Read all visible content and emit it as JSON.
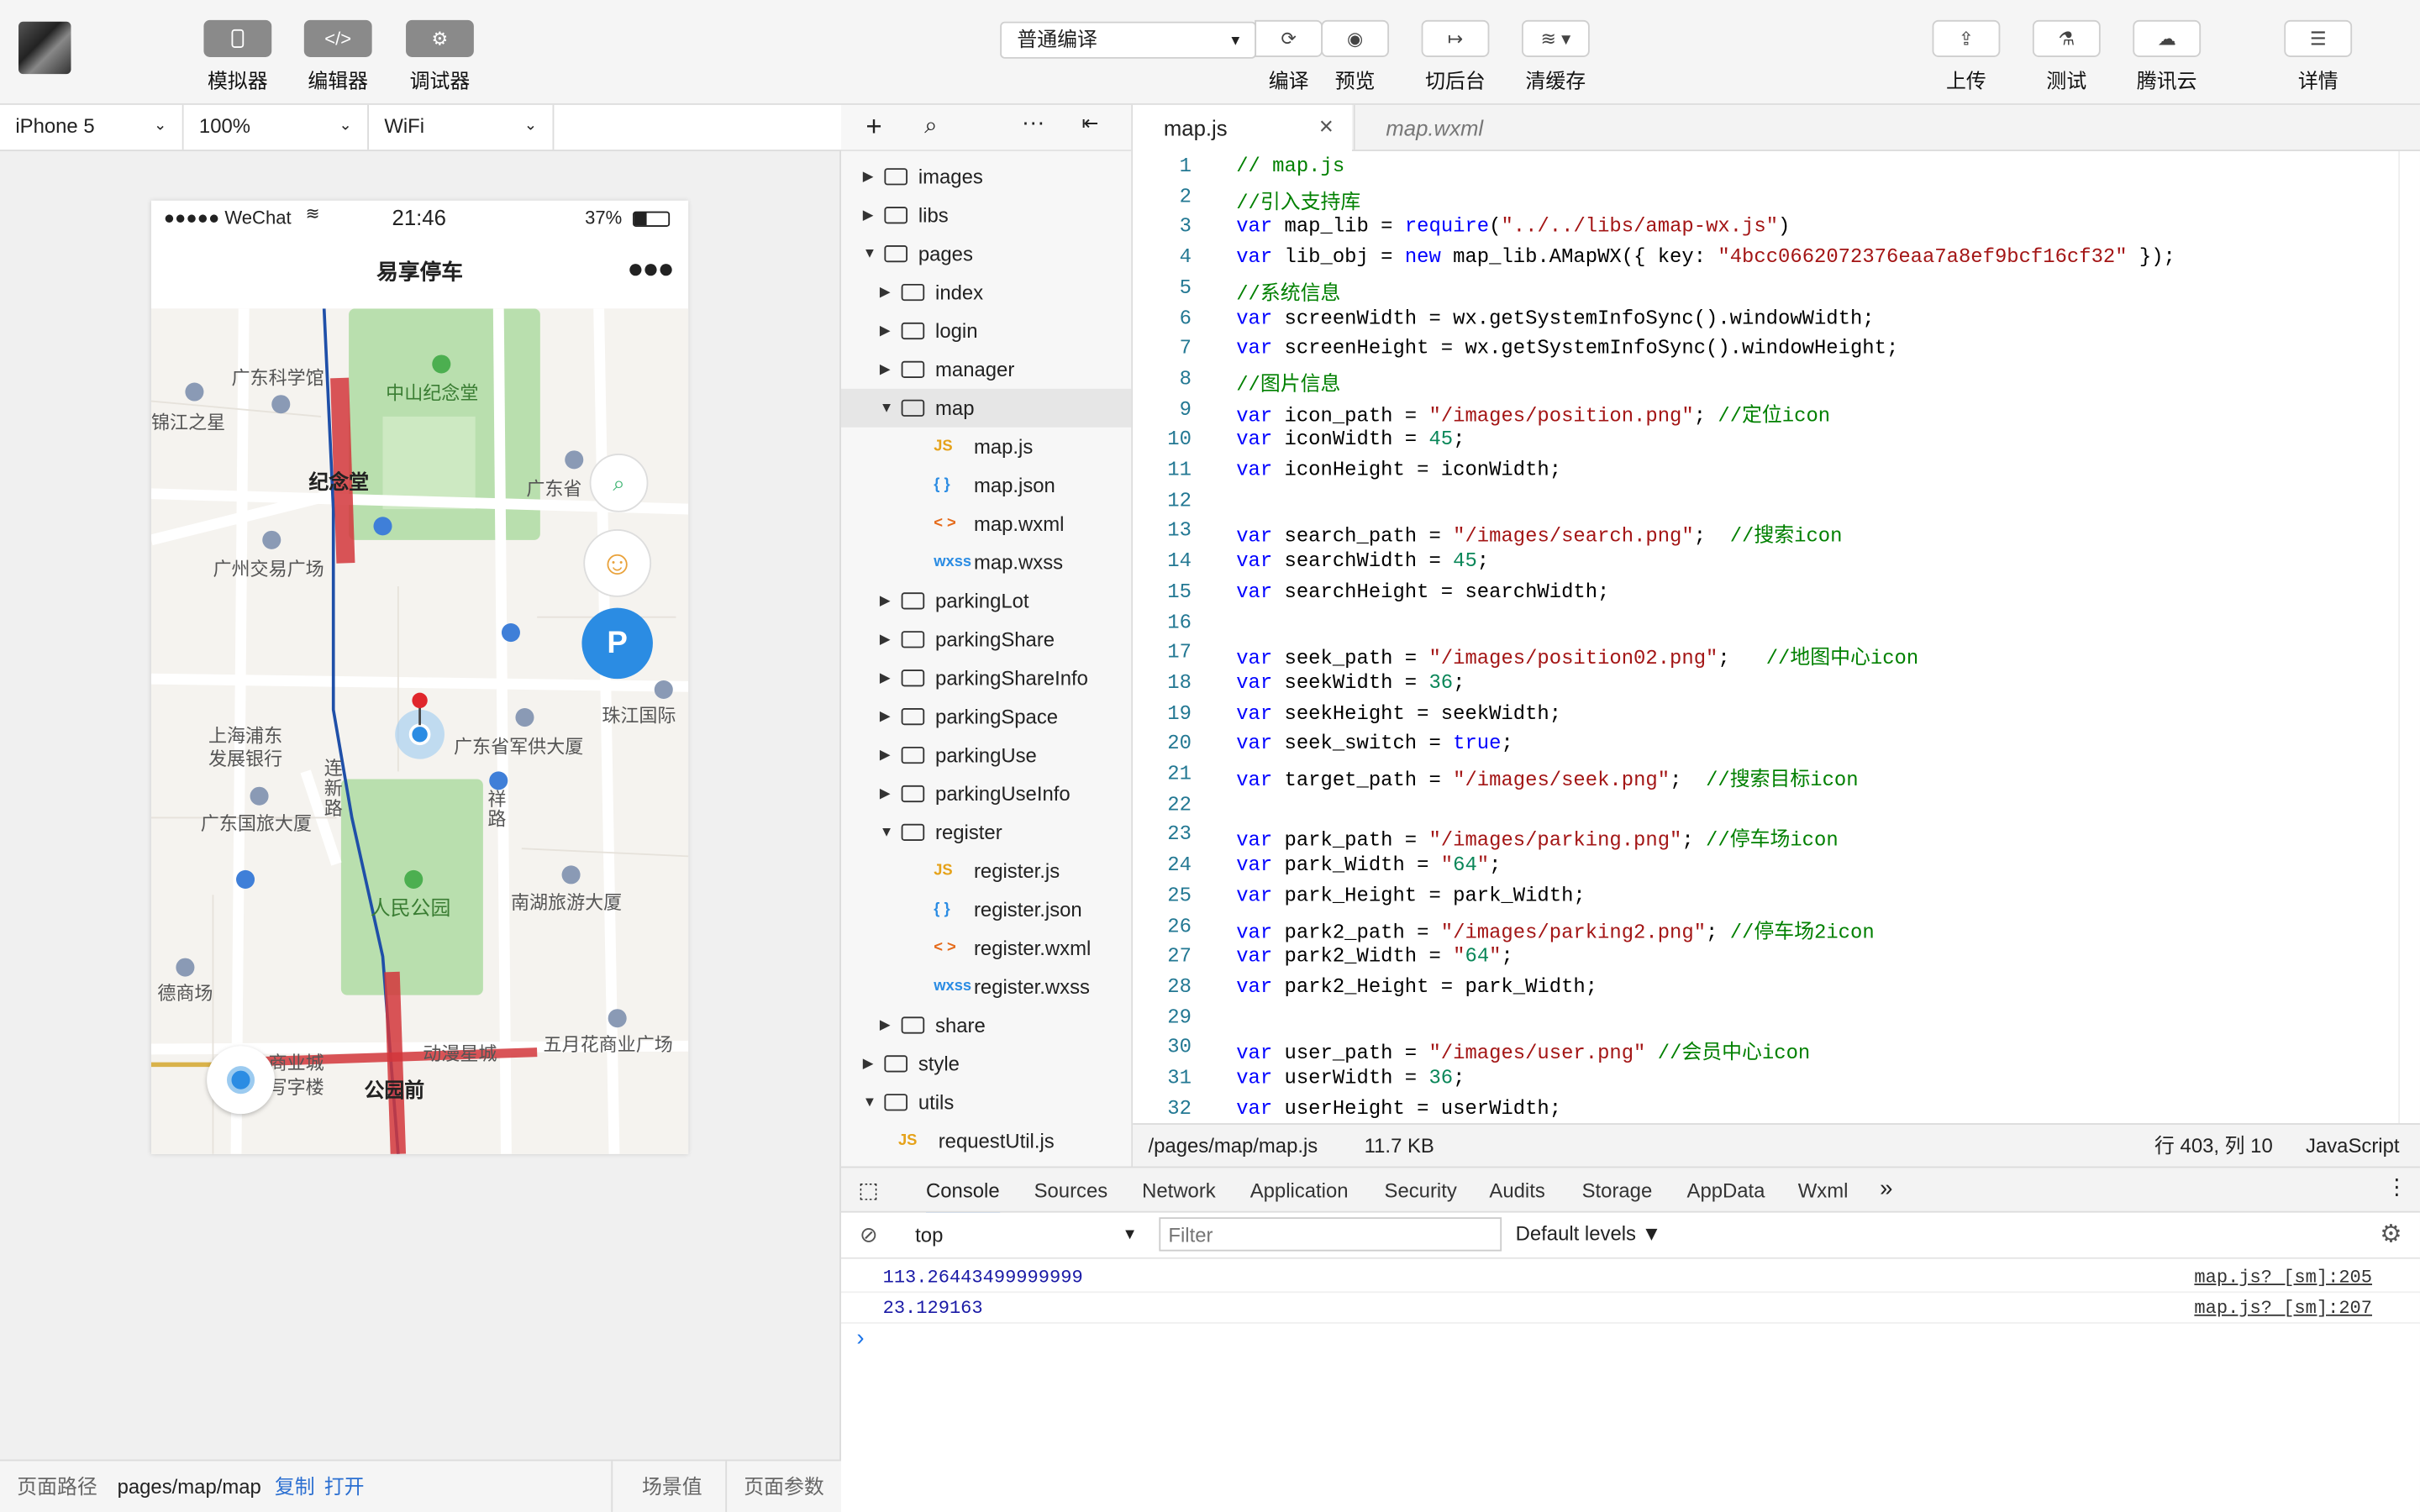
{
  "toolbar": {
    "simulator": "模拟器",
    "editor": "编辑器",
    "debugger": "调试器",
    "compile_mode": "普通编译",
    "compile": "编译",
    "preview": "预览",
    "background": "切后台",
    "clear_cache": "清缓存",
    "upload": "上传",
    "test": "测试",
    "tencent_cloud": "腾讯云",
    "details": "详情"
  },
  "device_bar": {
    "device": "iPhone 5",
    "zoom": "100%",
    "network": "WiFi"
  },
  "phone": {
    "signal": "●●●●● WeChat",
    "time": "21:46",
    "battery": "37%",
    "title": "易享停车",
    "more": "●●●"
  },
  "map": {
    "labels": [
      "广东科学馆",
      "锦江之星",
      "中山纪念堂",
      "纪念堂",
      "广东省",
      "广州交易广场",
      "珠江国际",
      "上海浦东",
      "发展银行",
      "广东省军供大厦",
      "连新路",
      "祥路",
      "广东国旅大厦",
      "人民公园",
      "南湖旅游大厦",
      "德商场",
      "五月花商业广场",
      "动漫星城",
      "商业城",
      "写字楼",
      "公园前"
    ]
  },
  "path_bar": {
    "label": "页面路径",
    "path": "pages/map/map",
    "copy": "复制",
    "open": "打开",
    "scene": "场景值",
    "params": "页面参数"
  },
  "tree": {
    "rows": [
      {
        "name": "images",
        "type": "folder",
        "depth": 0,
        "open": false
      },
      {
        "name": "libs",
        "type": "folder",
        "depth": 0,
        "open": false
      },
      {
        "name": "pages",
        "type": "folder",
        "depth": 0,
        "open": true
      },
      {
        "name": "index",
        "type": "folder",
        "depth": 1,
        "open": false
      },
      {
        "name": "login",
        "type": "folder",
        "depth": 1,
        "open": false
      },
      {
        "name": "manager",
        "type": "folder",
        "depth": 1,
        "open": false
      },
      {
        "name": "map",
        "type": "folder",
        "depth": 1,
        "open": true,
        "selected": true
      },
      {
        "name": "map.js",
        "type": "js",
        "depth": 2
      },
      {
        "name": "map.json",
        "type": "json",
        "depth": 2
      },
      {
        "name": "map.wxml",
        "type": "wxml",
        "depth": 2
      },
      {
        "name": "map.wxss",
        "type": "wxss",
        "depth": 2
      },
      {
        "name": "parkingLot",
        "type": "folder",
        "depth": 1,
        "open": false
      },
      {
        "name": "parkingShare",
        "type": "folder",
        "depth": 1,
        "open": false
      },
      {
        "name": "parkingShareInfo",
        "type": "folder",
        "depth": 1,
        "open": false
      },
      {
        "name": "parkingSpace",
        "type": "folder",
        "depth": 1,
        "open": false
      },
      {
        "name": "parkingUse",
        "type": "folder",
        "depth": 1,
        "open": false
      },
      {
        "name": "parkingUseInfo",
        "type": "folder",
        "depth": 1,
        "open": false
      },
      {
        "name": "register",
        "type": "folder",
        "depth": 1,
        "open": true
      },
      {
        "name": "register.js",
        "type": "js",
        "depth": 2
      },
      {
        "name": "register.json",
        "type": "json",
        "depth": 2
      },
      {
        "name": "register.wxml",
        "type": "wxml",
        "depth": 2
      },
      {
        "name": "register.wxss",
        "type": "wxss",
        "depth": 2
      },
      {
        "name": "share",
        "type": "folder",
        "depth": 1,
        "open": false
      },
      {
        "name": "style",
        "type": "folder",
        "depth": 0,
        "open": false
      },
      {
        "name": "utils",
        "type": "folder",
        "depth": 0,
        "open": true
      },
      {
        "name": "requestUtil.js",
        "type": "js",
        "depth": 1
      }
    ]
  },
  "editor": {
    "tabs": [
      "map.js",
      "map.wxml"
    ],
    "lines": [
      "// map.js",
      "//引入支持库",
      "var map_lib = require(\"../../libs/amap-wx.js\")",
      "var lib_obj = new map_lib.AMapWX({ key: \"4bcc0662072376eaa7a8ef9bcf16cf32\" });",
      "//系统信息",
      "var screenWidth = wx.getSystemInfoSync().windowWidth;",
      "var screenHeight = wx.getSystemInfoSync().windowHeight;",
      "//图片信息",
      "var icon_path = \"/images/position.png\"; //定位icon",
      "var iconWidth = 45;",
      "var iconHeight = iconWidth;",
      "",
      "var search_path = \"/images/search.png\";  //搜索icon",
      "var searchWidth = 45;",
      "var searchHeight = searchWidth;",
      "",
      "var seek_path = \"/images/position02.png\";   //地图中心icon",
      "var seekWidth = 36;",
      "var seekHeight = seekWidth;",
      "var seek_switch = true;",
      "var target_path = \"/images/seek.png\";  //搜索目标icon",
      "",
      "var park_path = \"/images/parking.png\"; //停车场icon",
      "var park_Width = \"64\";",
      "var park_Height = park_Width;",
      "var park2_path = \"/images/parking2.png\"; //停车场2icon",
      "var park2_Width = \"64\";",
      "var park2_Height = park_Width;",
      "",
      "var user_path = \"/images/user.png\" //会员中心icon",
      "var userWidth = 36;",
      "var userHeight = userWidth;"
    ],
    "status": {
      "path": "/pages/map/map.js",
      "size": "11.7 KB",
      "cursor": "行 403, 列 10",
      "language": "JavaScript"
    }
  },
  "devtools": {
    "tabs": [
      "Console",
      "Sources",
      "Network",
      "Application",
      "Security",
      "Audits",
      "Storage",
      "AppData",
      "Wxml"
    ],
    "more": "»",
    "context": "top",
    "filter_placeholder": "Filter",
    "levels": "Default levels ▼",
    "logs": [
      {
        "value": "113.26443499999999",
        "source": "map.js? [sm]:205"
      },
      {
        "value": "23.129163",
        "source": "map.js? [sm]:207"
      }
    ],
    "prompt": "›"
  },
  "colors": {
    "keyword": "#0000ff",
    "string": "#a31515",
    "comment": "#008000",
    "number": "#098658",
    "accent_blue": "#2b8ce3"
  }
}
